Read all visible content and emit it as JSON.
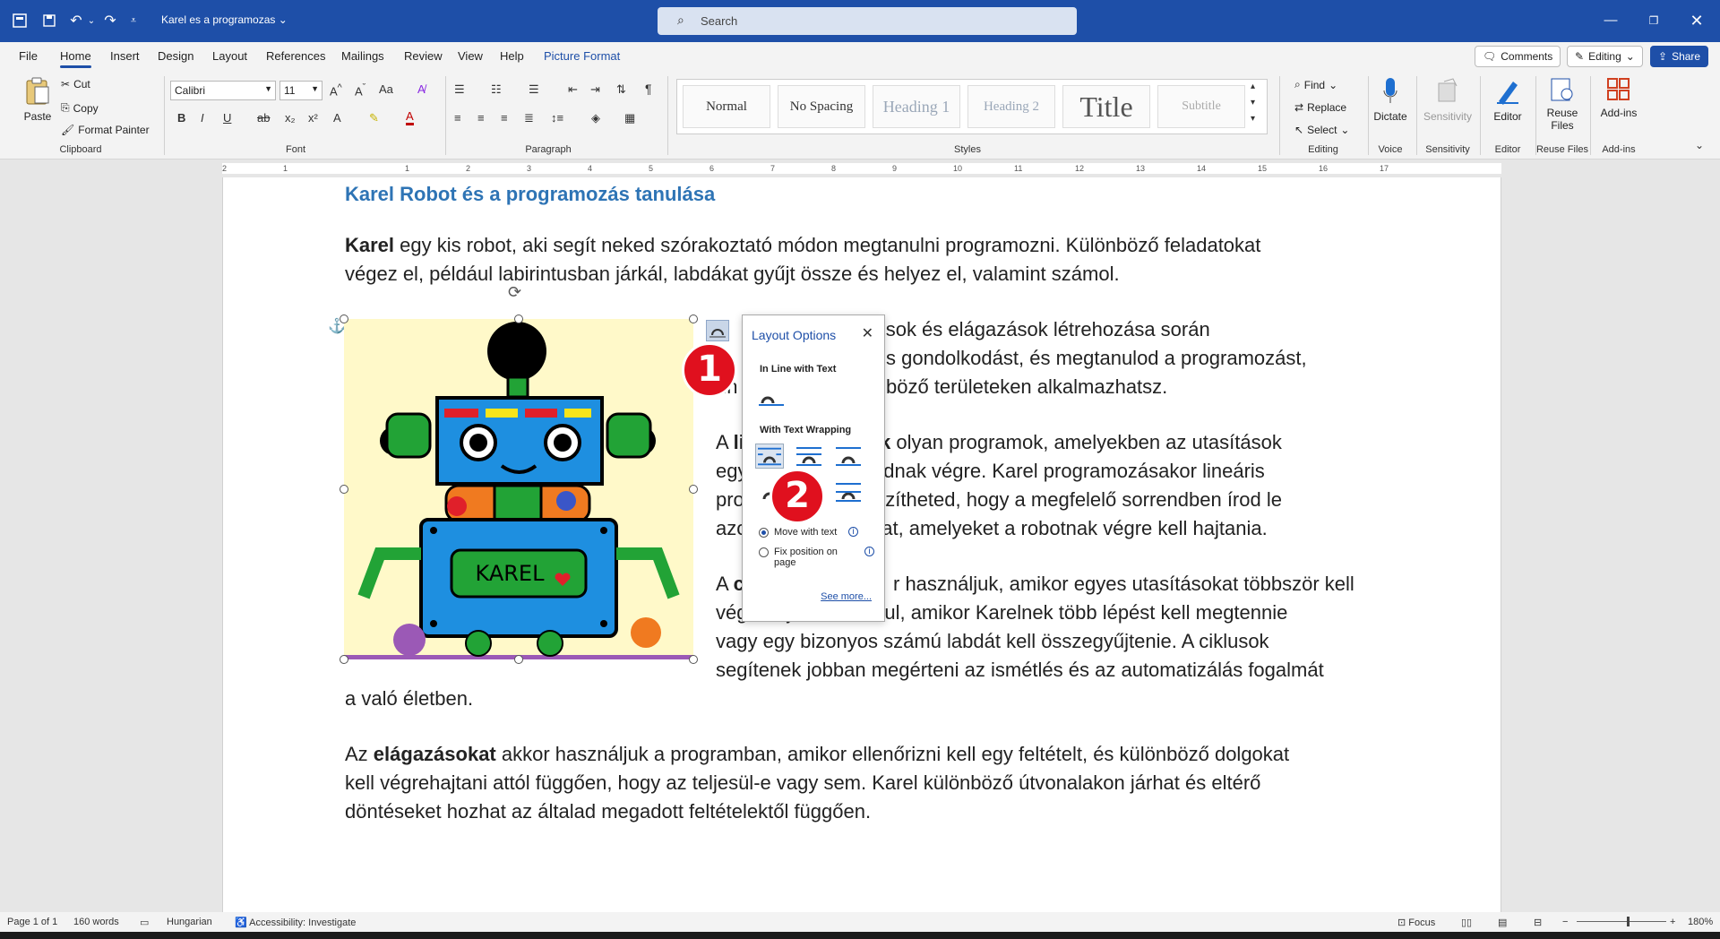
{
  "titlebar": {
    "doc_title": "Karel es a programozas",
    "search_placeholder": "Search"
  },
  "menu": {
    "tabs": [
      "File",
      "Home",
      "Insert",
      "Design",
      "Layout",
      "References",
      "Mailings",
      "Review",
      "View",
      "Help",
      "Picture Format"
    ],
    "comments": "Comments",
    "editing": "Editing",
    "share": "Share"
  },
  "ribbon": {
    "clipboard": {
      "paste": "Paste",
      "cut": "Cut",
      "copy": "Copy",
      "format_painter": "Format Painter",
      "label": "Clipboard"
    },
    "font": {
      "name": "Calibri",
      "size": "11",
      "label": "Font"
    },
    "paragraph": {
      "label": "Paragraph"
    },
    "styles": {
      "items": [
        "Normal",
        "No Spacing",
        "Heading 1",
        "Heading 2",
        "Title",
        "Subtitle"
      ],
      "label": "Styles"
    },
    "editing": {
      "find": "Find",
      "replace": "Replace",
      "select": "Select",
      "label": "Editing"
    },
    "voice": {
      "dictate": "Dictate",
      "label": "Voice"
    },
    "sensitivity": {
      "button": "Sensitivity",
      "label": "Sensitivity"
    },
    "editor": {
      "button": "Editor",
      "label": "Editor"
    },
    "reuse": {
      "button": "Reuse Files",
      "label": "Reuse Files"
    },
    "addins": {
      "button": "Add-ins",
      "label": "Add-ins"
    }
  },
  "ruler_numbers": [
    "2",
    "1",
    "1",
    "2",
    "3",
    "4",
    "5",
    "6",
    "7",
    "8",
    "9",
    "10",
    "11",
    "12",
    "13",
    "14",
    "15",
    "16",
    "17"
  ],
  "document": {
    "heading": "Karel Robot és a programozás tanulása",
    "p1_bold": "Karel",
    "p1_l1": " egy kis robot, aki segít neked szórakoztató módon megtanulni programozni. Különböző feladatokat",
    "p1_l2": "végez el, például labirintusban járkál, labdákat gyűjt össze és helyez el, valamint számol.",
    "p2_l1": "nok, ciklusok és elágazások létrehozása során",
    "p2_l2": "s gondolkodást, és megtanulod a programozást,",
    "p2_l3": "ún",
    "p2_l3b": "böző területeken alkalmazhatsz.",
    "p3_a": "A ",
    "p3_b": "li",
    "p3_c": "mok",
    "p3_d": " olyan programok, amelyekben az utasítások",
    "p3_l2a": "egy",
    "p3_l2b": "ódnak végre. Karel programozásakor lineáris",
    "p3_l3a": "pro",
    "p3_l3b": "készítheted, hogy a megfelelő sorrendben írod le",
    "p3_l4a": "azo",
    "p3_l4b": "okat, amelyeket a robotnak végre kell hajtania.",
    "p4_l1a": "A ",
    "p4_l1b": "c",
    "p4_l1c": "r használjuk, amikor egyes utasításokat többször kell",
    "p4_l2": "végrehajtani. Például, amikor Karelnek több lépést kell megtennie",
    "p4_l3": "vagy egy bizonyos számú labdát kell összegyűjtenie. A ciklusok",
    "p4_l4": "segítenek jobban megérteni az ismétlés és az automatizálás fogalmát",
    "p4_l5": "a való életben.",
    "p5_a": "Az ",
    "p5_bold": "elágazásokat",
    "p5_l1": " akkor használjuk a programban, amikor ellenőrizni kell egy feltételt, és különböző dolgokat",
    "p5_l2": "kell végrehajtani attól függően, hogy az teljesül-e vagy sem. Karel különböző útvonalakon járhat és eltérő",
    "p5_l3": "döntéseket hozhat az általad megadott feltételektől függően."
  },
  "picture": {
    "label": "KAREL"
  },
  "layout_options": {
    "title": "Layout Options",
    "inline_heading": "In Line with Text",
    "wrap_heading": "With Text Wrapping",
    "move_with_text": "Move with text",
    "fix_position": "Fix position on page",
    "see_more": "See more..."
  },
  "badges": {
    "one": "1",
    "two": "2"
  },
  "status": {
    "page": "Page 1 of 1",
    "words": "160 words",
    "language": "Hungarian",
    "accessibility": "Accessibility: Investigate",
    "focus": "Focus",
    "zoom": "180%"
  },
  "colors": {
    "brand": "#1e4fa8",
    "heading": "#2e74b5",
    "badge": "#e0101e"
  }
}
